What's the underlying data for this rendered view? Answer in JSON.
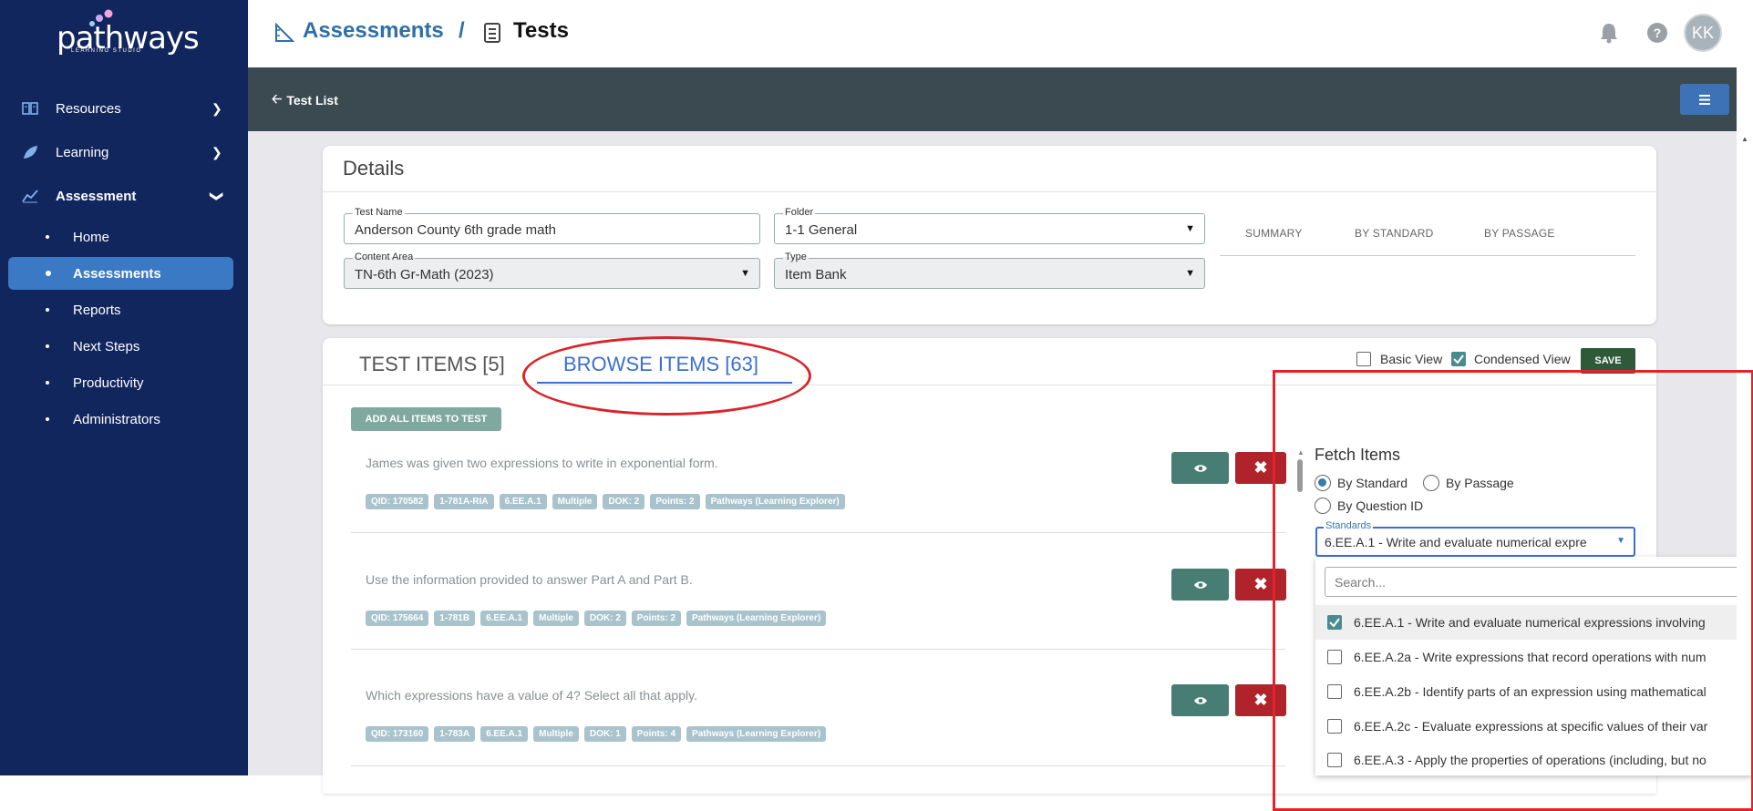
{
  "app": {
    "brand": "pathways",
    "brand_sub": "LEARNING STUDIO",
    "user_initials": "KK"
  },
  "sidebar": {
    "items": [
      {
        "label": "Resources",
        "icon": "book-icon"
      },
      {
        "label": "Learning",
        "icon": "leaf-icon"
      },
      {
        "label": "Assessment",
        "icon": "chart-line-icon"
      }
    ],
    "assessment_sub": [
      "Home",
      "Assessments",
      "Reports",
      "Next Steps",
      "Productivity",
      "Administrators"
    ],
    "active_sub": "Assessments"
  },
  "breadcrumb": {
    "first": "Assessments",
    "separator": "/",
    "second": "Tests"
  },
  "toolbar": {
    "back_label": "Test List"
  },
  "details": {
    "title": "Details",
    "test_name_label": "Test Name",
    "test_name_value": "Anderson County 6th grade math",
    "folder_label": "Folder",
    "folder_value": "1-1 General",
    "content_area_label": "Content Area",
    "content_area_value": "TN-6th Gr-Math (2023)",
    "type_label": "Type",
    "type_value": "Item Bank",
    "summary_tabs": [
      "SUMMARY",
      "BY STANDARD",
      "BY PASSAGE"
    ]
  },
  "items_panel": {
    "tab_test_items": "TEST ITEMS [5]",
    "tab_browse_items": "BROWSE ITEMS [63]",
    "basic_view_label": "Basic View",
    "basic_view_checked": false,
    "condensed_view_label": "Condensed View",
    "condensed_view_checked": true,
    "save_label": "SAVE",
    "add_all_label": "ADD ALL ITEMS TO TEST",
    "items": [
      {
        "question": "James was given two expressions to write in exponential form.",
        "tags": [
          "QID: 170582",
          "1-781A-RIA",
          "6.EE.A.1",
          "Multiple",
          "DOK: 2",
          "Points: 2",
          "Pathways (Learning Explorer)"
        ]
      },
      {
        "question": "Use the information provided to answer Part A and Part B.",
        "tags": [
          "QID: 175664",
          "1-781B",
          "6.EE.A.1",
          "Multiple",
          "DOK: 2",
          "Points: 2",
          "Pathways (Learning Explorer)"
        ]
      },
      {
        "question": "Which expressions have a value of 4? Select all that apply.",
        "tags": [
          "QID: 173160",
          "1-783A",
          "6.EE.A.1",
          "Multiple",
          "DOK: 1",
          "Points: 4",
          "Pathways (Learning Explorer)"
        ]
      }
    ]
  },
  "fetch": {
    "title": "Fetch Items",
    "by_standard": "By Standard",
    "by_passage": "By Passage",
    "by_question_id": "By Question ID",
    "selected_mode": "By Standard",
    "standards_label": "Standards",
    "standards_value": "6.EE.A.1 - Write and evaluate numerical expre",
    "search_placeholder": "Search...",
    "options": [
      {
        "label": "6.EE.A.1 - Write and evaluate numerical expressions involving",
        "checked": true
      },
      {
        "label": "6.EE.A.2a - Write expressions that record operations with num",
        "checked": false
      },
      {
        "label": "6.EE.A.2b - Identify parts of an expression using mathematical",
        "checked": false
      },
      {
        "label": "6.EE.A.2c - Evaluate expressions at specific values of their var",
        "checked": false
      },
      {
        "label": "6.EE.A.3 - Apply the properties of operations (including, but no",
        "checked": false
      }
    ]
  },
  "colors": {
    "sidebar": "#12265e",
    "active": "#3b79c4",
    "toolbar": "#3a4a50",
    "link": "#2f6fa8",
    "save": "#2f5a3a",
    "highlight": "#e0242b"
  }
}
